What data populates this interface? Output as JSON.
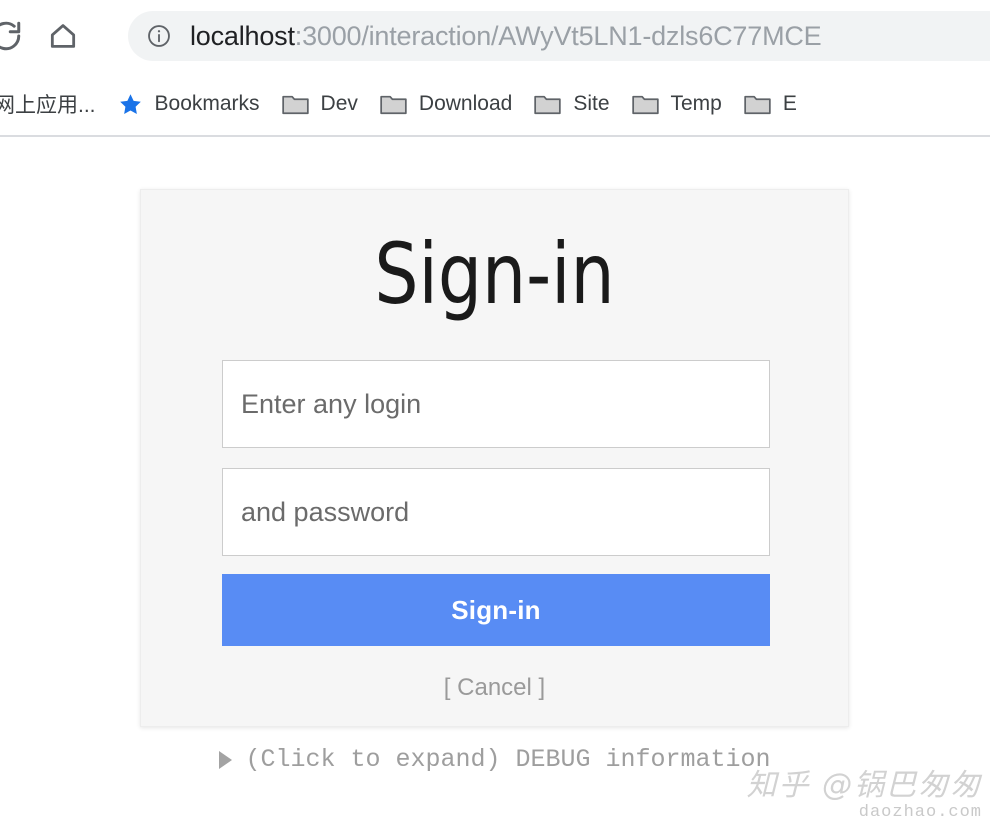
{
  "browser": {
    "toolbar": {
      "reload_icon": "reload-icon",
      "home_icon": "home-icon"
    },
    "omnibox": {
      "info_icon": "info-circle-icon",
      "url_host": "localhost",
      "url_rest": ":3000/interaction/AWyVt5LN1-dzls6C77MCE",
      "full_url": "localhost:3000/interaction/AWyVt5LN1-dzls6C77MCE"
    },
    "bookmarks": [
      {
        "label": "网上应用...",
        "icon": "favicon-generic"
      },
      {
        "label": "Bookmarks",
        "icon": "star-icon"
      },
      {
        "label": "Dev",
        "icon": "folder-icon"
      },
      {
        "label": "Download",
        "icon": "folder-icon"
      },
      {
        "label": "Site",
        "icon": "folder-icon"
      },
      {
        "label": "Temp",
        "icon": "folder-icon"
      },
      {
        "label": "E",
        "icon": "folder-icon"
      }
    ]
  },
  "signin": {
    "title": "Sign-in",
    "login_placeholder": "Enter any login",
    "login_value": "",
    "password_placeholder": "and password",
    "password_value": "",
    "submit_label": "Sign-in",
    "cancel_label": "[ Cancel ]",
    "button_color": "#588cf4",
    "card_background": "#f6f6f6"
  },
  "debug": {
    "summary_label": "(Click to expand) DEBUG information",
    "expanded": false
  },
  "watermark": {
    "main": "知乎 @锅巴匆匆",
    "sub": "daozhao.com"
  }
}
